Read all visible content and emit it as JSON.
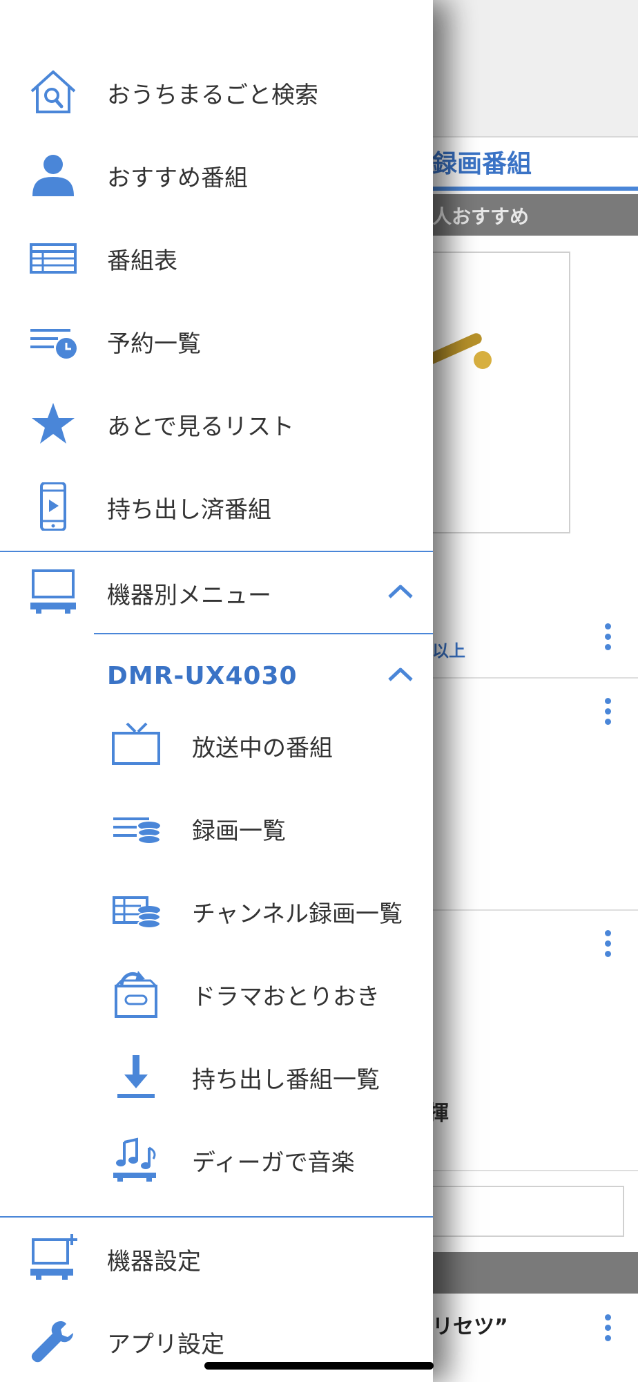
{
  "background": {
    "title_partial": "録画番組",
    "subbar_partial": "人おすすめ",
    "meta_partial": "以上",
    "char_partial": "揮",
    "bottom_text_partial": "リセツ”"
  },
  "menu": {
    "items": [
      {
        "label": "おうちまるごと検索",
        "icon": "home-search-icon"
      },
      {
        "label": "おすすめ番組",
        "icon": "person-icon"
      },
      {
        "label": "番組表",
        "icon": "program-guide-icon"
      },
      {
        "label": "予約一覧",
        "icon": "reservation-list-icon"
      },
      {
        "label": "あとで見るリスト",
        "icon": "star-icon"
      },
      {
        "label": "持ち出し済番組",
        "icon": "phone-play-icon"
      }
    ],
    "device_menu": {
      "label": "機器別メニュー",
      "icon": "monitor-icon",
      "expanded": true
    },
    "device": {
      "name": "DMR-UX4030",
      "expanded": true,
      "items": [
        {
          "label": "放送中の番組",
          "icon": "tv-icon"
        },
        {
          "label": "録画一覧",
          "icon": "recording-list-icon"
        },
        {
          "label": "チャンネル録画一覧",
          "icon": "channel-recording-icon"
        },
        {
          "label": "ドラマおとりおき",
          "icon": "drama-box-icon"
        },
        {
          "label": "持ち出し番組一覧",
          "icon": "download-icon"
        },
        {
          "label": "ディーガで音楽",
          "icon": "music-icon"
        }
      ]
    },
    "bottom_items": [
      {
        "label": "機器設定",
        "icon": "device-settings-icon"
      },
      {
        "label": "アプリ設定",
        "icon": "wrench-icon"
      }
    ]
  },
  "colors": {
    "accent": "#4a86d8",
    "text": "#333333",
    "device_name": "#3a73c6"
  }
}
